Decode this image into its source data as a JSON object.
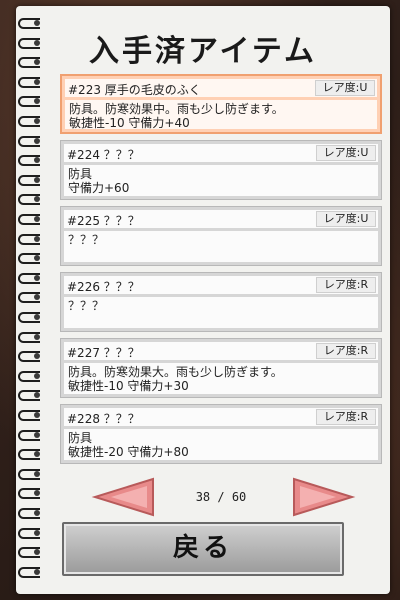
{
  "title": "入手済アイテム",
  "items": [
    {
      "name": "#223 厚手の毛皮のふく",
      "rarity": "レア度:U",
      "desc": "防具。防寒効果中。雨も少し防ぎます。\n敏捷性-10 守備力+40",
      "selected": true
    },
    {
      "name": "#224 ？？？",
      "rarity": "レア度:U",
      "desc": "防具\n守備力+60"
    },
    {
      "name": "#225 ？？？",
      "rarity": "レア度:U",
      "desc": "？？？"
    },
    {
      "name": "#226 ？？？",
      "rarity": "レア度:R",
      "desc": "？？？"
    },
    {
      "name": "#227 ？？？",
      "rarity": "レア度:R",
      "desc": "防具。防寒効果大。雨も少し防ぎます。\n敏捷性-10 守備力+30"
    },
    {
      "name": "#228 ？？？",
      "rarity": "レア度:R",
      "desc": "防具\n敏捷性-20 守備力+80"
    }
  ],
  "pager": {
    "text": "38 / 60"
  },
  "back_label": "戻る",
  "colors": {
    "arrow": "#e88a8a",
    "selected_bg": "#ffd0b4",
    "selected_border": "#f0a070"
  },
  "icons": {
    "prev": "left-triangle-arrow",
    "next": "right-triangle-arrow"
  }
}
